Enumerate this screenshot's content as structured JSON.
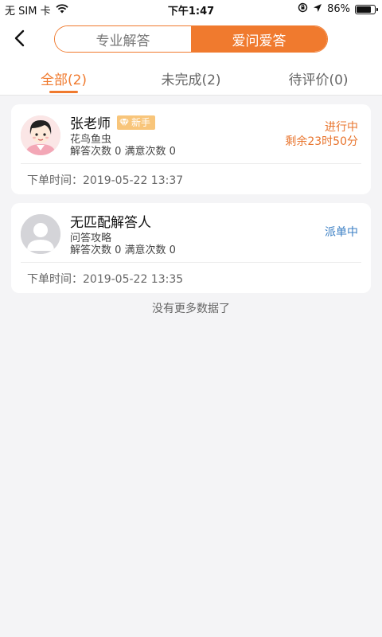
{
  "status_bar": {
    "carrier": "无 SIM 卡",
    "time": "下午1:47",
    "battery": "86%",
    "battery_level": 0.86
  },
  "nav": {
    "segments": [
      {
        "label": "专业解答",
        "active": false
      },
      {
        "label": "爱问爱答",
        "active": true
      }
    ]
  },
  "tabs": [
    {
      "label": "全部(2)",
      "active": true
    },
    {
      "label": "未完成(2)",
      "active": false
    },
    {
      "label": "待评价(0)",
      "active": false
    }
  ],
  "orders": [
    {
      "name": "张老师",
      "badge": "新手",
      "category": "花鸟鱼虫",
      "counts": "解答次数 0 满意次数 0",
      "status": "进行中",
      "remaining": "剩余23时50分",
      "order_time": "下单时间：2019-05-22 13:37"
    },
    {
      "name": "无匹配解答人",
      "category": "问答攻略",
      "counts": "解答次数 0 满意次数 0",
      "status": "派单中",
      "order_time": "下单时间：2019-05-22 13:35"
    }
  ],
  "footer": {
    "no_more": "没有更多数据了"
  },
  "colors": {
    "accent": "#f07a2e",
    "blue_status": "#3b7fc4",
    "badge": "#f8c57a"
  }
}
